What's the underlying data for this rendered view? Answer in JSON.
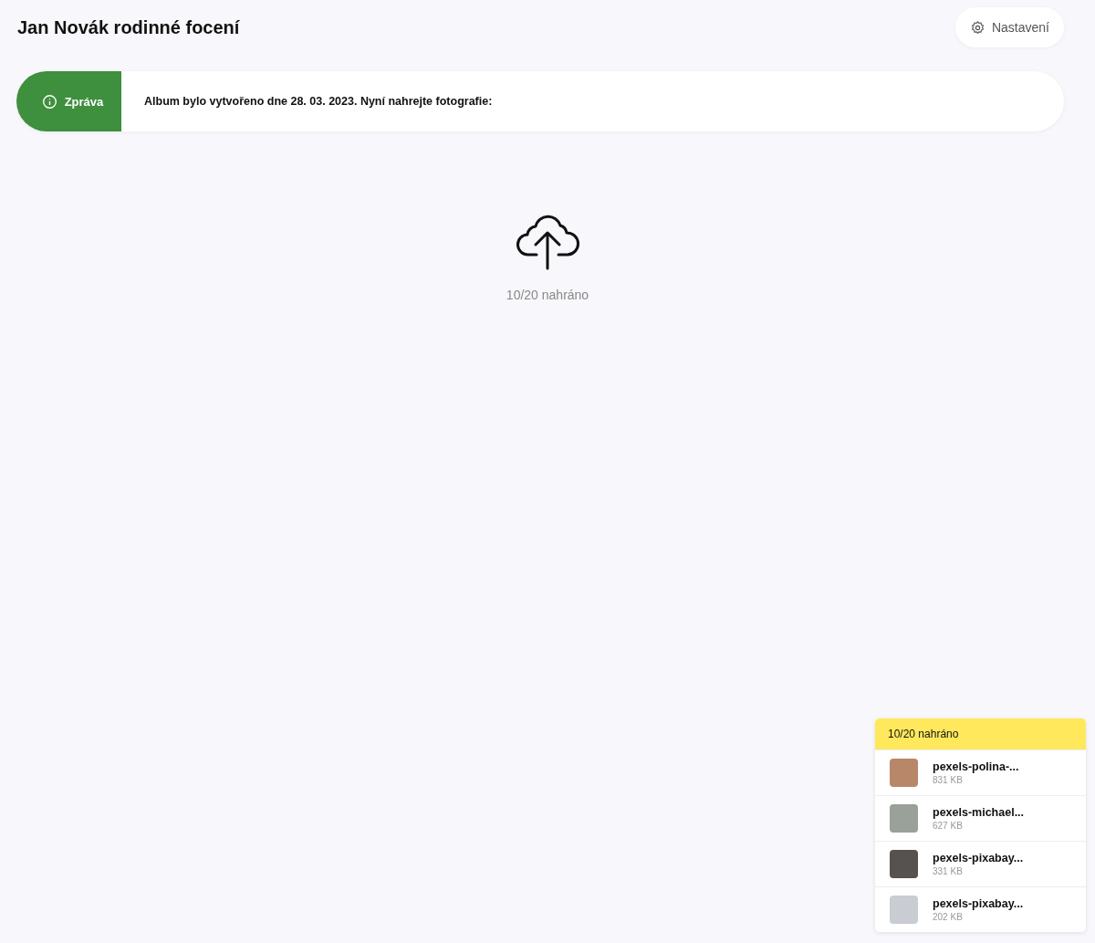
{
  "header": {
    "title": "Jan Novák rodinné focení",
    "settings_button": "Nastavení"
  },
  "message": {
    "label": "Zpráva",
    "text": "Album bylo vytvořeno dne 28. 03. 2023. Nyní nahrejte fotografie:"
  },
  "upload_area": {
    "status": "10/20 nahráno"
  },
  "upload_panel": {
    "title": "10/20 nahráno",
    "files": [
      {
        "name": "pexels-polina-...",
        "size": "831 KB"
      },
      {
        "name": "pexels-michael...",
        "size": "627 KB"
      },
      {
        "name": "pexels-pixabay...",
        "size": "331 KB"
      },
      {
        "name": "pexels-pixabay...",
        "size": "202 KB"
      }
    ]
  }
}
